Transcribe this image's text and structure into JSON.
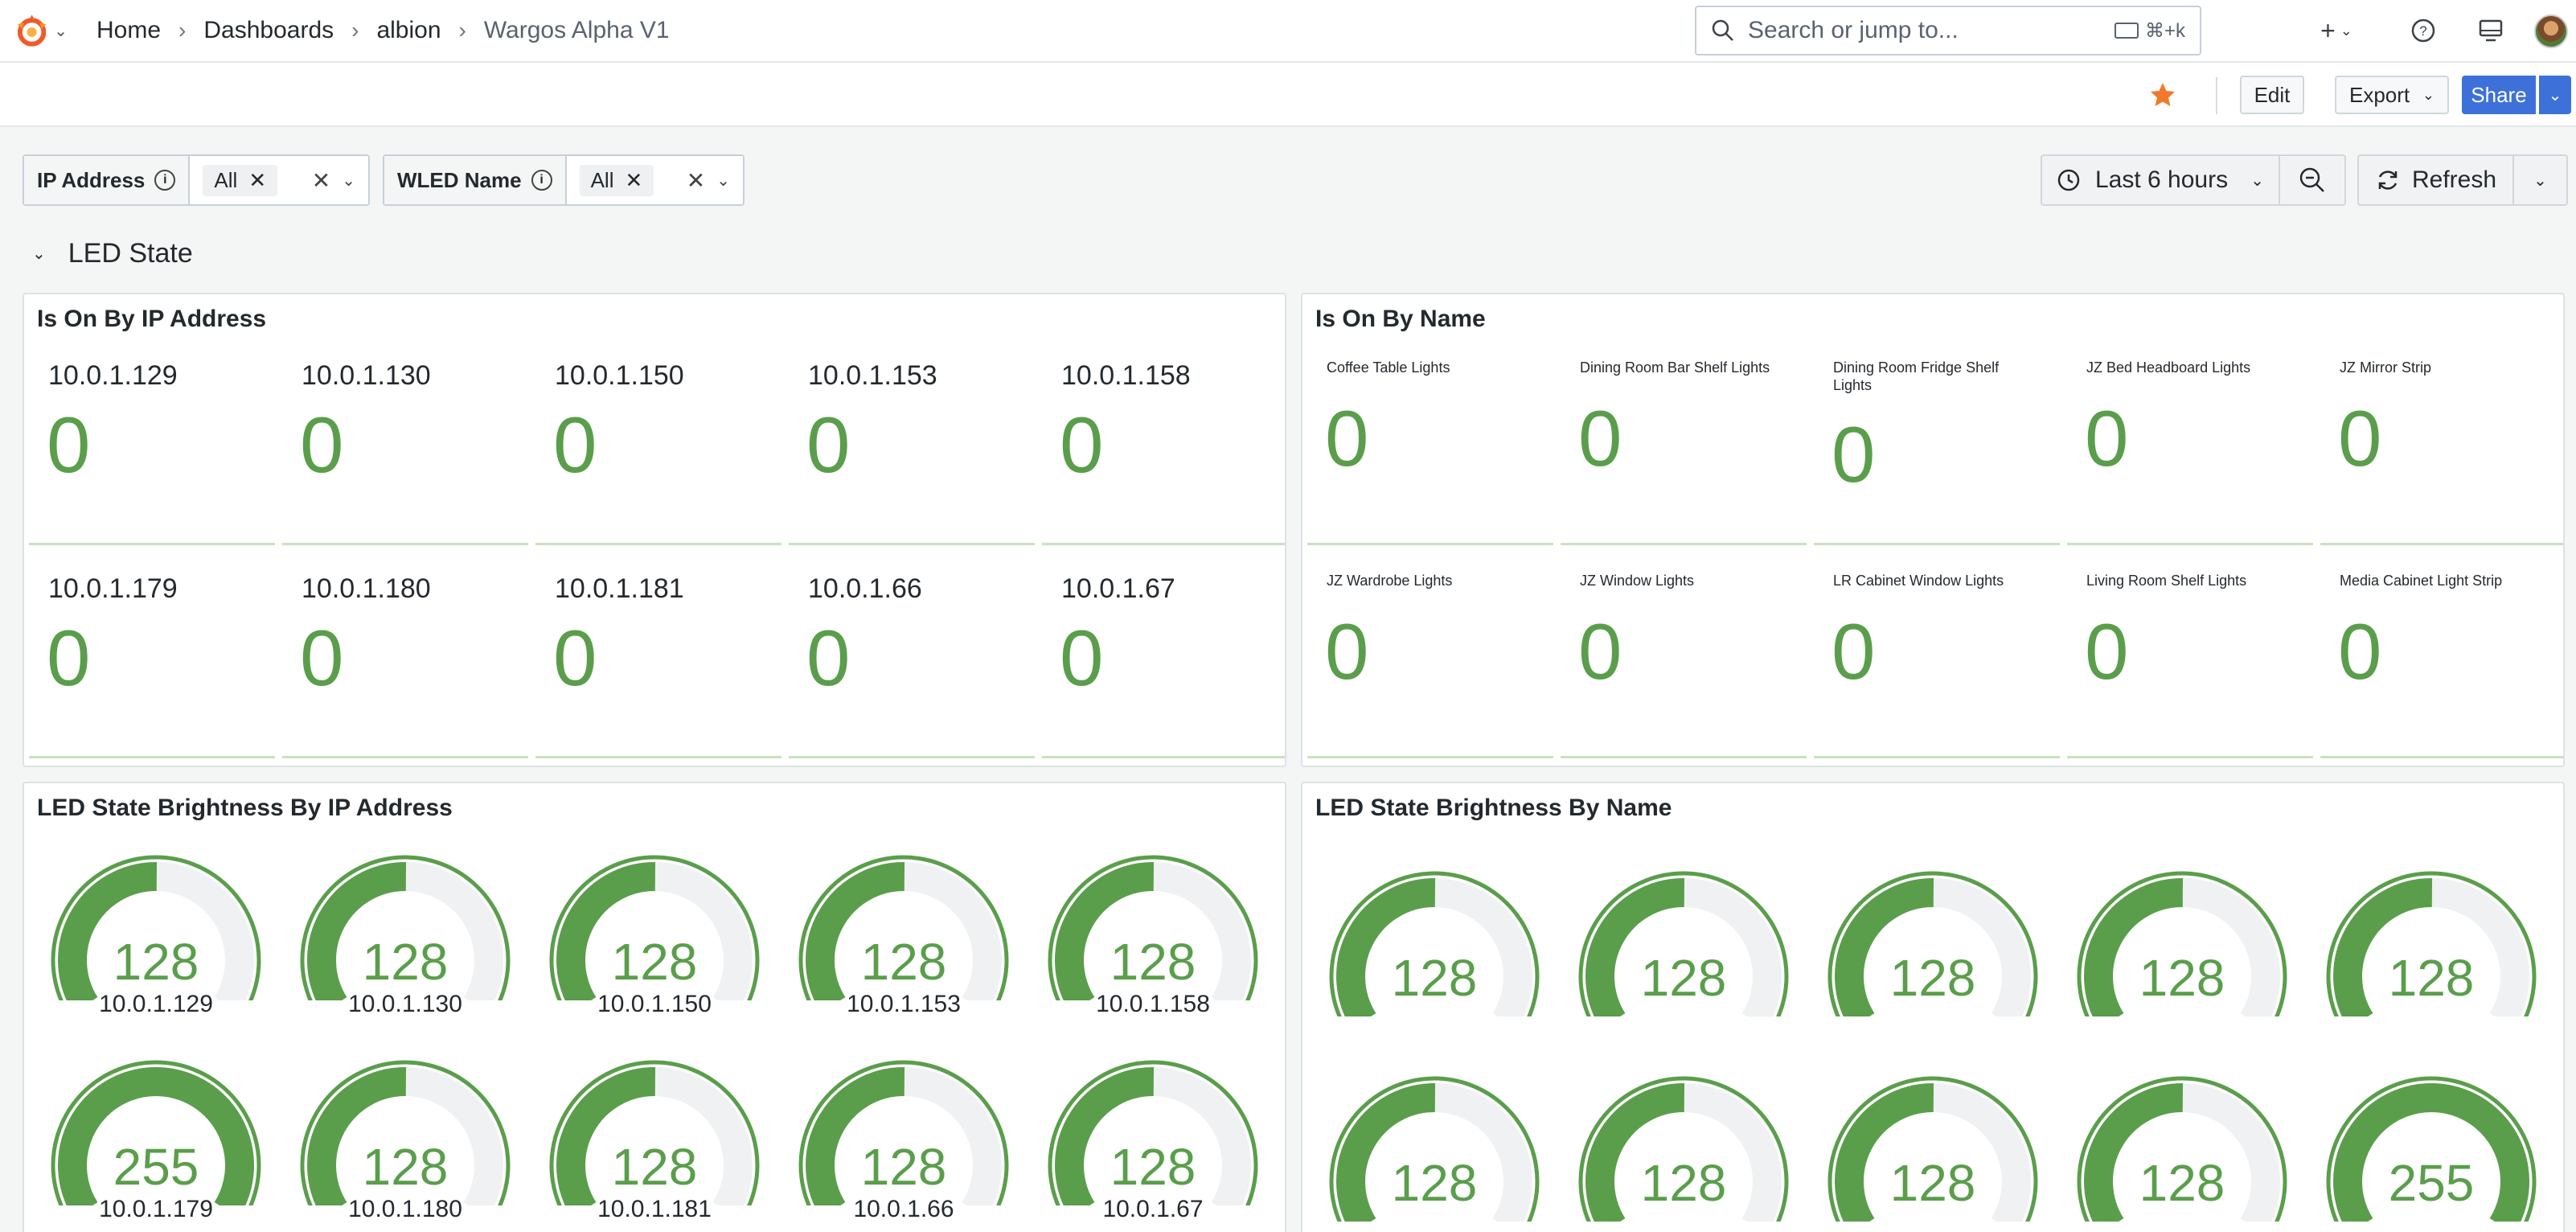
{
  "navbar": {
    "breadcrumbs": [
      "Home",
      "Dashboards",
      "albion",
      "Wargos Alpha V1"
    ],
    "search_placeholder": "Search or jump to...",
    "search_shortcut": "⌘+k",
    "add_icon": "plus-icon",
    "help_icon": "help-icon",
    "kiosk_icon": "monitor-icon"
  },
  "toolbar": {
    "edit_label": "Edit",
    "export_label": "Export",
    "share_label": "Share",
    "starred": true,
    "star_color": "#f2792b",
    "share_color": "#3d71d9"
  },
  "variables": [
    {
      "label": "IP Address",
      "value": "All"
    },
    {
      "label": "WLED Name",
      "value": "All"
    }
  ],
  "time_range": {
    "label": "Last 6 hours"
  },
  "refresh": {
    "label": "Refresh"
  },
  "row": {
    "title": "LED State"
  },
  "panels": {
    "on_by_ip": {
      "title": "Is On By IP Address",
      "items": [
        {
          "label": "10.0.1.129",
          "value": "0"
        },
        {
          "label": "10.0.1.130",
          "value": "0"
        },
        {
          "label": "10.0.1.150",
          "value": "0"
        },
        {
          "label": "10.0.1.153",
          "value": "0"
        },
        {
          "label": "10.0.1.158",
          "value": "0"
        },
        {
          "label": "10.0.1.179",
          "value": "0"
        },
        {
          "label": "10.0.1.180",
          "value": "0"
        },
        {
          "label": "10.0.1.181",
          "value": "0"
        },
        {
          "label": "10.0.1.66",
          "value": "0"
        },
        {
          "label": "10.0.1.67",
          "value": "0"
        }
      ]
    },
    "on_by_name": {
      "title": "Is On By Name",
      "items": [
        {
          "label": "Coffee Table Lights",
          "value": "0"
        },
        {
          "label": "Dining Room Bar Shelf Lights",
          "value": "0"
        },
        {
          "label": "Dining Room Fridge Shelf Lights",
          "value": "0"
        },
        {
          "label": "JZ Bed Headboard Lights",
          "value": "0"
        },
        {
          "label": "JZ Mirror Strip",
          "value": "0"
        },
        {
          "label": "JZ Wardrobe Lights",
          "value": "0"
        },
        {
          "label": "JZ Window Lights",
          "value": "0"
        },
        {
          "label": "LR Cabinet Window Lights",
          "value": "0"
        },
        {
          "label": "Living Room Shelf Lights",
          "value": "0"
        },
        {
          "label": "Media Cabinet Light Strip",
          "value": "0"
        }
      ]
    },
    "brightness_by_ip": {
      "title": "LED State Brightness By IP Address",
      "max": 255,
      "items": [
        {
          "label": "10.0.1.129",
          "value": 128
        },
        {
          "label": "10.0.1.130",
          "value": 128
        },
        {
          "label": "10.0.1.150",
          "value": 128
        },
        {
          "label": "10.0.1.153",
          "value": 128
        },
        {
          "label": "10.0.1.158",
          "value": 128
        },
        {
          "label": "10.0.1.179",
          "value": 255
        },
        {
          "label": "10.0.1.180",
          "value": 128
        },
        {
          "label": "10.0.1.181",
          "value": 128
        },
        {
          "label": "10.0.1.66",
          "value": 128
        },
        {
          "label": "10.0.1.67",
          "value": 128
        }
      ]
    },
    "brightness_by_name": {
      "title": "LED State Brightness By Name",
      "max": 255,
      "items": [
        {
          "value": 128
        },
        {
          "value": 128
        },
        {
          "value": 128
        },
        {
          "value": 128
        },
        {
          "value": 128
        },
        {
          "value": 128
        },
        {
          "value": 128
        },
        {
          "value": 128
        },
        {
          "value": 128
        },
        {
          "value": 255
        }
      ]
    }
  },
  "colors": {
    "value_green": "#5a9e4b",
    "gauge_track": "#f0f1f2"
  }
}
